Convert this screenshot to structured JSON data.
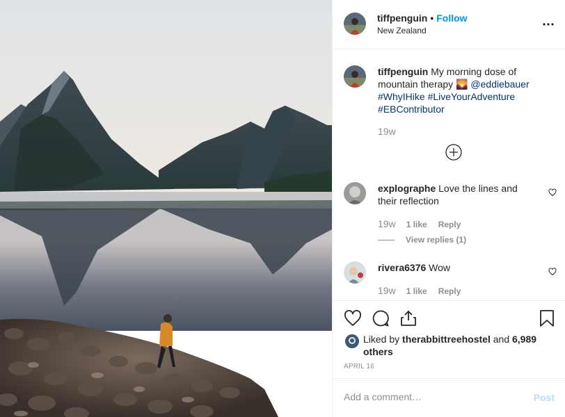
{
  "post": {
    "username": "tiffpenguin",
    "dot": "•",
    "follow_label": "Follow",
    "location": "New Zealand",
    "more_icon": "more-horizontal-icon"
  },
  "caption": {
    "username": "tiffpenguin",
    "text_before": " My morning dose of mountain therapy ",
    "emoji": "🌄",
    "mention": "@eddiebauer",
    "hashtags": [
      "#WhyIHike",
      "#LiveYourAdventure",
      "#EBContributor"
    ],
    "time": "19w"
  },
  "comments": [
    {
      "username": "explographe",
      "text": " Love the lines and their reflection",
      "time": "19w",
      "likes": "1 like",
      "reply_label": "Reply",
      "view_replies": "View replies (1)"
    },
    {
      "username": "rivera6376",
      "text": " Wow",
      "time": "19w",
      "likes": "1 like",
      "reply_label": "Reply"
    }
  ],
  "likes": {
    "prefix": "Liked by ",
    "user": "therabbittreehostel",
    "middle": " and ",
    "others": "6,989 others"
  },
  "date": "APRIL 16",
  "add_comment": {
    "placeholder": "Add a comment…",
    "post_label": "Post"
  },
  "colors": {
    "accent": "#0095f6",
    "link": "#00376b",
    "muted": "#8e8e8e",
    "post_disabled": "#b2dffc"
  }
}
